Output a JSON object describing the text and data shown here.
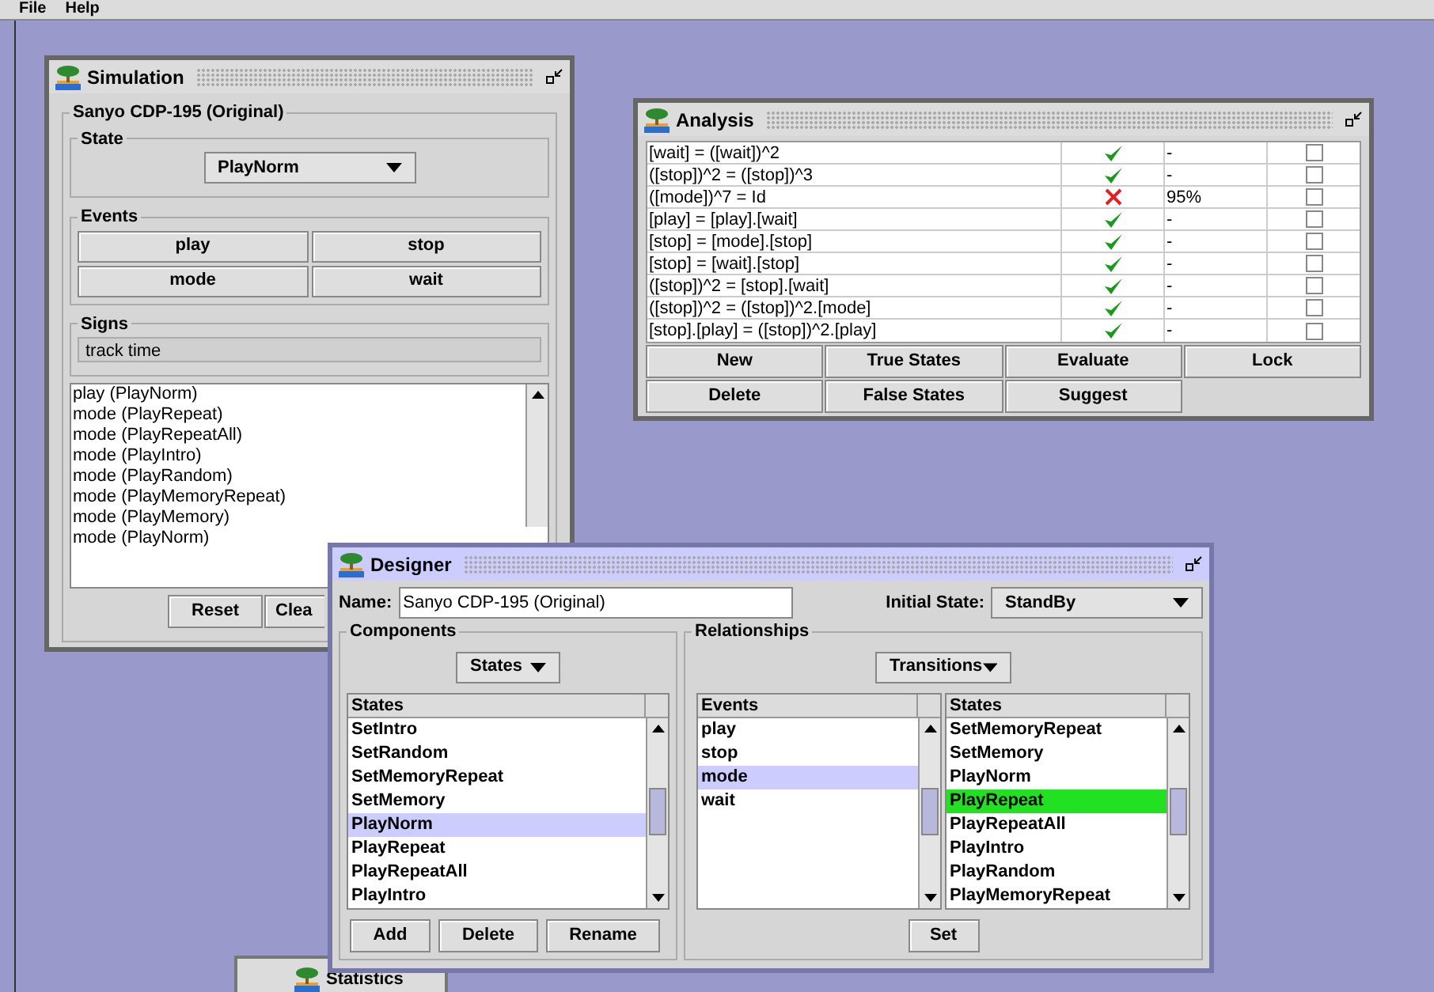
{
  "menu": [
    "File",
    "Help"
  ],
  "simulation": {
    "title": "Simulation",
    "group": "Sanyo CDP-195 (Original)",
    "state_label": "State",
    "state_value": "PlayNorm",
    "events_label": "Events",
    "events": [
      "play",
      "stop",
      "mode",
      "wait"
    ],
    "signs_label": "Signs",
    "signs_value": "track time",
    "log": [
      "play (PlayNorm)",
      "mode (PlayRepeat)",
      "mode (PlayRepeatAll)",
      "mode (PlayIntro)",
      "mode (PlayRandom)",
      "mode (PlayMemoryRepeat)",
      "mode (PlayMemory)",
      "mode (PlayNorm)"
    ],
    "buttons": [
      "Reset",
      "Clea"
    ]
  },
  "analysis": {
    "title": "Analysis",
    "rows": [
      {
        "formula": "[wait] = ([wait])^2",
        "valid": true,
        "result": "-",
        "checked": false
      },
      {
        "formula": "([stop])^2 = ([stop])^3",
        "valid": true,
        "result": "-",
        "checked": false
      },
      {
        "formula": "([mode])^7 = Id",
        "valid": false,
        "result": "95%",
        "checked": false
      },
      {
        "formula": "[play] = [play].[wait]",
        "valid": true,
        "result": "-",
        "checked": false
      },
      {
        "formula": "[stop] = [mode].[stop]",
        "valid": true,
        "result": "-",
        "checked": false
      },
      {
        "formula": "[stop] = [wait].[stop]",
        "valid": true,
        "result": "-",
        "checked": false
      },
      {
        "formula": "([stop])^2 = [stop].[wait]",
        "valid": true,
        "result": "-",
        "checked": false
      },
      {
        "formula": "([stop])^2 = ([stop])^2.[mode]",
        "valid": true,
        "result": "-",
        "checked": false
      },
      {
        "formula": "[stop].[play] = ([stop])^2.[play]",
        "valid": true,
        "result": "-",
        "checked": false
      }
    ],
    "buttons": [
      "New",
      "True States",
      "Evaluate",
      "Lock",
      "Delete",
      "False States",
      "Suggest"
    ]
  },
  "designer": {
    "title": "Designer",
    "name_label": "Name:",
    "name_value": "Sanyo CDP-195 (Original)",
    "initial_label": "Initial State:",
    "initial_value": "StandBy",
    "components": {
      "label": "Components",
      "combo": "States",
      "header": "States",
      "items": [
        {
          "label": "SetIntro",
          "selected": false
        },
        {
          "label": "SetRandom",
          "selected": false
        },
        {
          "label": "SetMemoryRepeat",
          "selected": false
        },
        {
          "label": "SetMemory",
          "selected": false
        },
        {
          "label": "PlayNorm",
          "selected": true
        },
        {
          "label": "PlayRepeat",
          "selected": false
        },
        {
          "label": "PlayRepeatAll",
          "selected": false
        },
        {
          "label": "PlayIntro",
          "selected": false
        }
      ],
      "buttons": [
        "Add",
        "Delete",
        "Rename"
      ]
    },
    "relationships": {
      "label": "Relationships",
      "combo": "Transitions",
      "events_header": "Events",
      "events": [
        {
          "label": "play",
          "selected": false
        },
        {
          "label": "stop",
          "selected": false
        },
        {
          "label": "mode",
          "selected": true
        },
        {
          "label": "wait",
          "selected": false
        }
      ],
      "states_header": "States",
      "states": [
        {
          "label": "SetMemoryRepeat",
          "selected": false
        },
        {
          "label": "SetMemory",
          "selected": false
        },
        {
          "label": "PlayNorm",
          "selected": false
        },
        {
          "label": "PlayRepeat",
          "selected": true
        },
        {
          "label": "PlayRepeatAll",
          "selected": false
        },
        {
          "label": "PlayIntro",
          "selected": false
        },
        {
          "label": "PlayRandom",
          "selected": false
        },
        {
          "label": "PlayMemoryRepeat",
          "selected": false
        }
      ],
      "button": "Set"
    }
  },
  "statistics": {
    "title": "Statistics"
  }
}
